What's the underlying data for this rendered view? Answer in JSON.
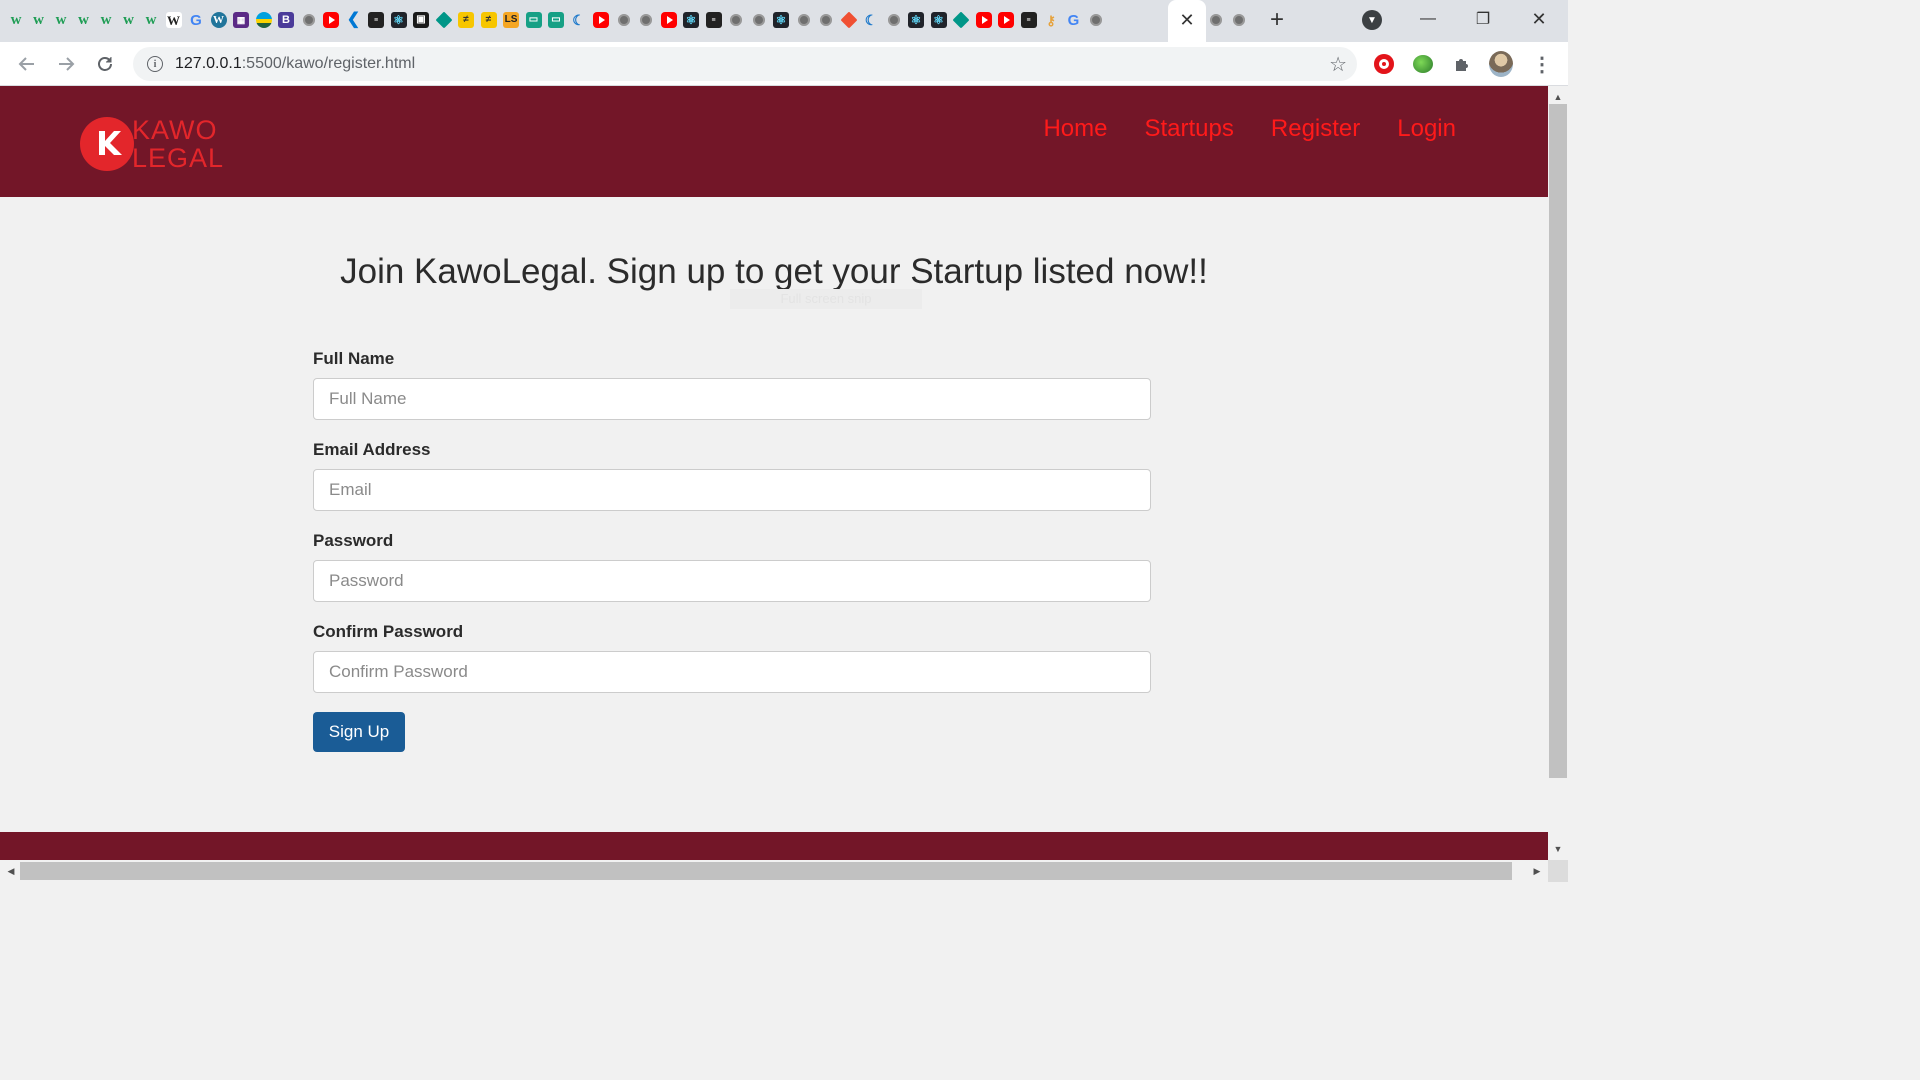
{
  "browser": {
    "tab_icons": [
      "w-icon",
      "w-icon",
      "w-icon",
      "w-icon",
      "w-icon",
      "w-icon",
      "w-icon",
      "wikipedia-icon",
      "google-icon",
      "wordpress-icon",
      "grid-icon",
      "flag-icon",
      "b-icon",
      "globe-icon",
      "youtube-icon",
      "vscode-icon",
      "dark-site-icon",
      "react-icon",
      "save-icon",
      "green-diamond-icon",
      "yellow-site-icon",
      "yellow-site-icon",
      "ls-icon",
      "teal-site-icon",
      "teal-site-icon",
      "moon-icon",
      "youtube-icon",
      "globe-icon",
      "globe-icon",
      "youtube-icon",
      "react-icon",
      "dark-site-icon",
      "globe-icon",
      "globe-icon",
      "react-icon",
      "globe-icon",
      "globe-icon",
      "orange-diamond-icon",
      "moon-icon",
      "globe-icon",
      "react-icon",
      "react-icon",
      "green-diamond-icon",
      "youtube-icon",
      "youtube-icon",
      "dark-site-icon",
      "key-icon",
      "google-icon",
      "globe-icon"
    ],
    "active_tab_close": "✕",
    "trailing_tab_icons": [
      "globe-icon",
      "globe-icon"
    ],
    "new_tab": "+",
    "url_host": "127.0.0.1",
    "url_path": ":5500/kawo/register.html",
    "window_controls": {
      "minimize": "—",
      "restore": "❐",
      "close": "✕"
    }
  },
  "site": {
    "logo": {
      "line1": "KAWO",
      "line2": "LEGAL"
    },
    "nav": [
      "Home",
      "Startups",
      "Register",
      "Login"
    ],
    "colors": {
      "header": "#731628",
      "accent_red": "#e3262b",
      "nav_link": "#ff1a1a",
      "button": "#1a5c96"
    }
  },
  "page": {
    "headline": "Join KawoLegal. Sign up to get your Startup listed now!!",
    "ghost_text": "Full screen snip",
    "form": {
      "fields": [
        {
          "label": "Full Name",
          "placeholder": "Full Name"
        },
        {
          "label": "Email Address",
          "placeholder": "Email"
        },
        {
          "label": "Password",
          "placeholder": "Password"
        },
        {
          "label": "Confirm Password",
          "placeholder": "Confirm Password"
        }
      ],
      "submit": "Sign Up"
    }
  }
}
